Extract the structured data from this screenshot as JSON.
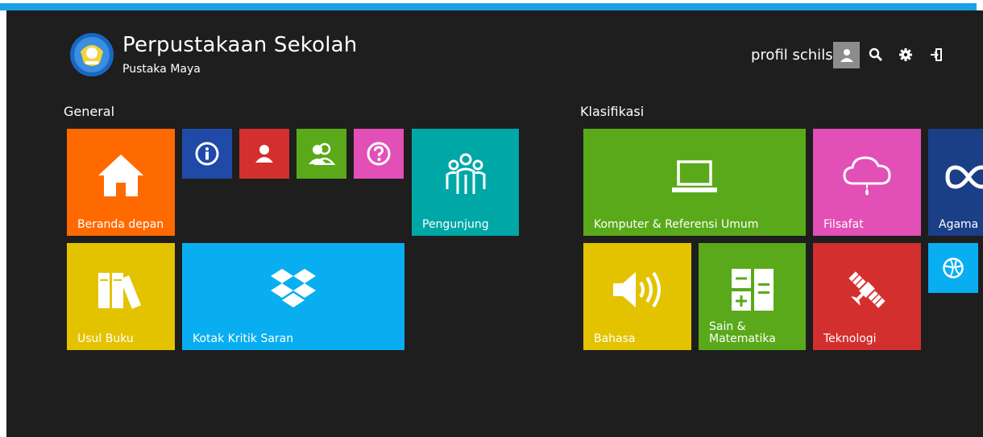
{
  "header": {
    "title": "Perpustakaan Sekolah",
    "subtitle": "Pustaka Maya",
    "profile_name": "profil schils"
  },
  "icons": {
    "avatar": "user-icon",
    "search": "search-icon",
    "settings": "gear-icon",
    "logout": "exit-icon"
  },
  "sections": {
    "general": "General",
    "klasifikasi": "Klasifikasi"
  },
  "tiles": {
    "beranda": {
      "label": "Beranda depan",
      "icon": "home-icon",
      "color": "#ff6a00"
    },
    "info": {
      "label": "",
      "icon": "info-icon",
      "color": "#1f4aa8"
    },
    "user": {
      "label": "",
      "icon": "user-icon",
      "color": "#d32f2f"
    },
    "users": {
      "label": "",
      "icon": "users-icon",
      "color": "#5aa91a"
    },
    "help": {
      "label": "",
      "icon": "help-icon",
      "color": "#e24fb7"
    },
    "pengunjung": {
      "label": "Pengunjung",
      "icon": "group-icon",
      "color": "#00a7a7"
    },
    "usul_buku": {
      "label": "Usul Buku",
      "icon": "books-icon",
      "color": "#e3c300"
    },
    "kotak_kritik": {
      "label": "Kotak Kritik Saran",
      "icon": "dropbox-icon",
      "color": "#08aef0"
    },
    "komputer": {
      "label": "Komputer & Referensi Umum",
      "icon": "laptop-icon",
      "color": "#5aa91a"
    },
    "filsafat": {
      "label": "Filsafat",
      "icon": "cloud-rain-icon",
      "color": "#e24fb7"
    },
    "agama": {
      "label": "Agama",
      "icon": "infinity-icon",
      "color": "#1a3f86"
    },
    "bahasa": {
      "label": "Bahasa",
      "icon": "speaker-icon",
      "color": "#e3c300"
    },
    "sain": {
      "label_line1": "Sain &",
      "label_line2": "Matematika",
      "icon": "calculator-icon",
      "color": "#5aa91a"
    },
    "teknologi": {
      "label": "Teknologi",
      "icon": "satellite-icon",
      "color": "#d32f2f"
    },
    "sport": {
      "label": "",
      "icon": "basketball-icon",
      "color": "#08aef0"
    }
  }
}
